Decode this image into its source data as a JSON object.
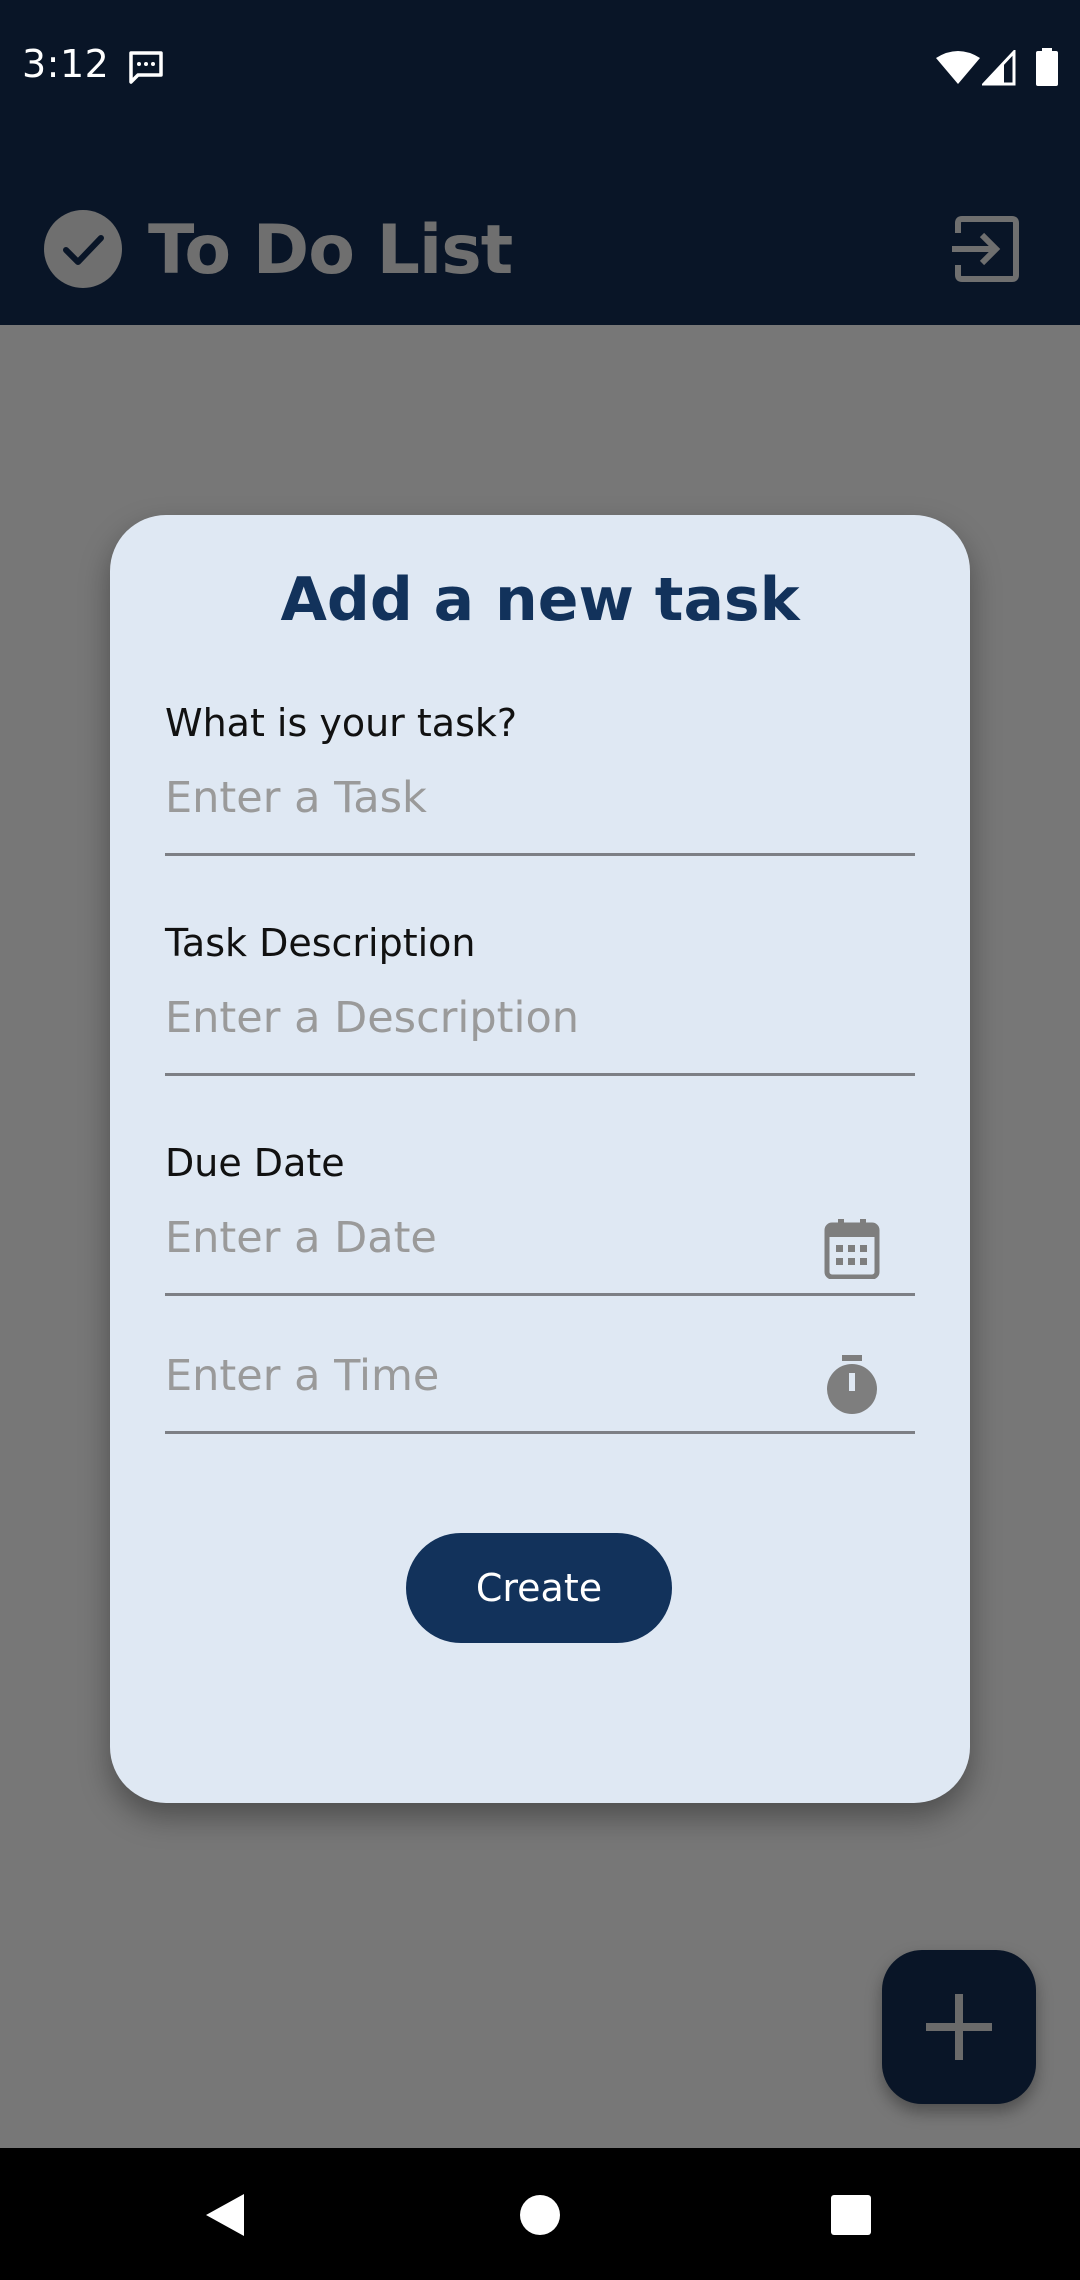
{
  "status_bar": {
    "time": "3:12"
  },
  "app_bar": {
    "title": "To Do List",
    "logo_icon": "check-circle-icon",
    "logout_icon": "logout-icon"
  },
  "dialog": {
    "title": "Add a new task",
    "task_label": "What is your task?",
    "task_placeholder": "Enter a Task",
    "task_value": "",
    "description_label": "Task Description",
    "description_placeholder": "Enter a Description",
    "description_value": "",
    "due_date_label": "Due Date",
    "date_placeholder": "Enter a Date",
    "date_value": "",
    "time_placeholder": "Enter a Time",
    "time_value": "",
    "create_label": "Create"
  },
  "colors": {
    "app_bar_bg": "#091527",
    "dialog_bg": "#dfe8f3",
    "accent": "#12325b",
    "scrim": "#777777"
  }
}
